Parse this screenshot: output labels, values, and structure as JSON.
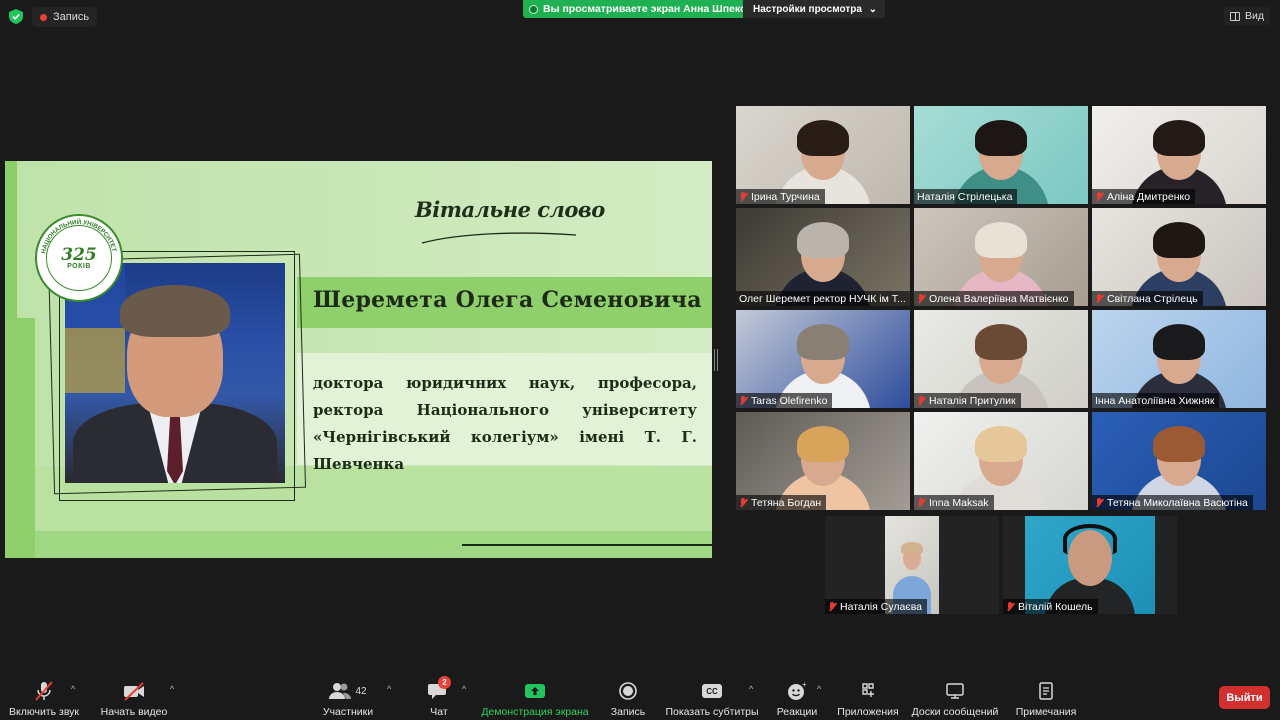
{
  "topbar": {
    "record_label": "Запись",
    "viewing_text": "Вы просматриваете экран Анна Шпеко",
    "view_settings_label": "Настройки просмотра",
    "view_label": "Вид"
  },
  "slide": {
    "title": "Вітальне слово",
    "name": "Шеремета Олега Семеновича",
    "description": "доктора юридичних наук, професора, ректора Національного університету «Чернігівський колегіум» імені Т. Г. Шевченка",
    "logo_number": "325",
    "logo_years": "РОКІВ",
    "logo_ring_text": "НАЦІОНАЛЬНИЙ УНІВЕРСИТЕТ"
  },
  "participants": [
    {
      "name": "Ірина Турчина",
      "muted": true
    },
    {
      "name": "Наталія Стрілецька",
      "muted": false
    },
    {
      "name": "Аліна Дмитренко",
      "muted": true
    },
    {
      "name": "Олег Шеремет ректор НУЧК ім Т...",
      "muted": false,
      "active": true
    },
    {
      "name": "Олена Валеріївна Матвієнко",
      "muted": true
    },
    {
      "name": "Світлана Стрілець",
      "muted": true
    },
    {
      "name": "Taras Olefirenko",
      "muted": true
    },
    {
      "name": "Наталія Притулик",
      "muted": true
    },
    {
      "name": "Інна Анатоліївна Хижняк",
      "muted": false
    },
    {
      "name": "Тетяна Богдан",
      "muted": true
    },
    {
      "name": "Inna Maksak",
      "muted": true
    },
    {
      "name": "Тетяна Миколаївна Васютіна",
      "muted": true
    },
    {
      "name": "Наталія Сулаєва",
      "muted": true
    },
    {
      "name": "Віталій Кошель",
      "muted": true
    }
  ],
  "toolbar": {
    "unmute_label": "Включить звук",
    "start_video_label": "Начать видео",
    "participants_label": "Участники",
    "participants_count": "42",
    "chat_label": "Чат",
    "chat_badge": "2",
    "share_label": "Демонстрация экрана",
    "record_label": "Запись",
    "captions_label": "Показать субтитры",
    "captions_icon_text": "CC",
    "reactions_label": "Реакции",
    "apps_label": "Приложения",
    "whiteboards_label": "Доски сообщений",
    "notes_label": "Примечания",
    "exit_label": "Выйти"
  },
  "colors": {
    "zoom_green": "#1fb151",
    "exit_red": "#d22f2f",
    "slide_green": "#8fd06d",
    "active_speaker_outline": "#d6e36a"
  }
}
